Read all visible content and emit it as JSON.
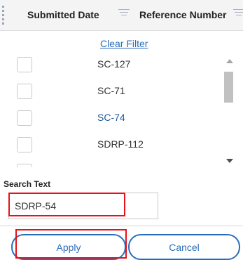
{
  "header": {
    "columns": [
      {
        "label": "Submitted Date",
        "icon": "filter-icon"
      },
      {
        "label": "Reference Number",
        "icon": "filter-icon"
      }
    ]
  },
  "filter": {
    "clear_label": "Clear Filter",
    "items": [
      {
        "label": "SC-127",
        "checked": false
      },
      {
        "label": "SC-71",
        "checked": false
      },
      {
        "label": "SC-74",
        "checked": false,
        "active": true
      },
      {
        "label": "SDRP-112",
        "checked": false
      }
    ],
    "search_label": "Search Text",
    "search_value": "SDRP-54",
    "apply_label": "Apply",
    "cancel_label": "Cancel"
  },
  "colors": {
    "link": "#2a6ebb",
    "active_item": "#1f5a96",
    "highlight": "#e8101a"
  }
}
